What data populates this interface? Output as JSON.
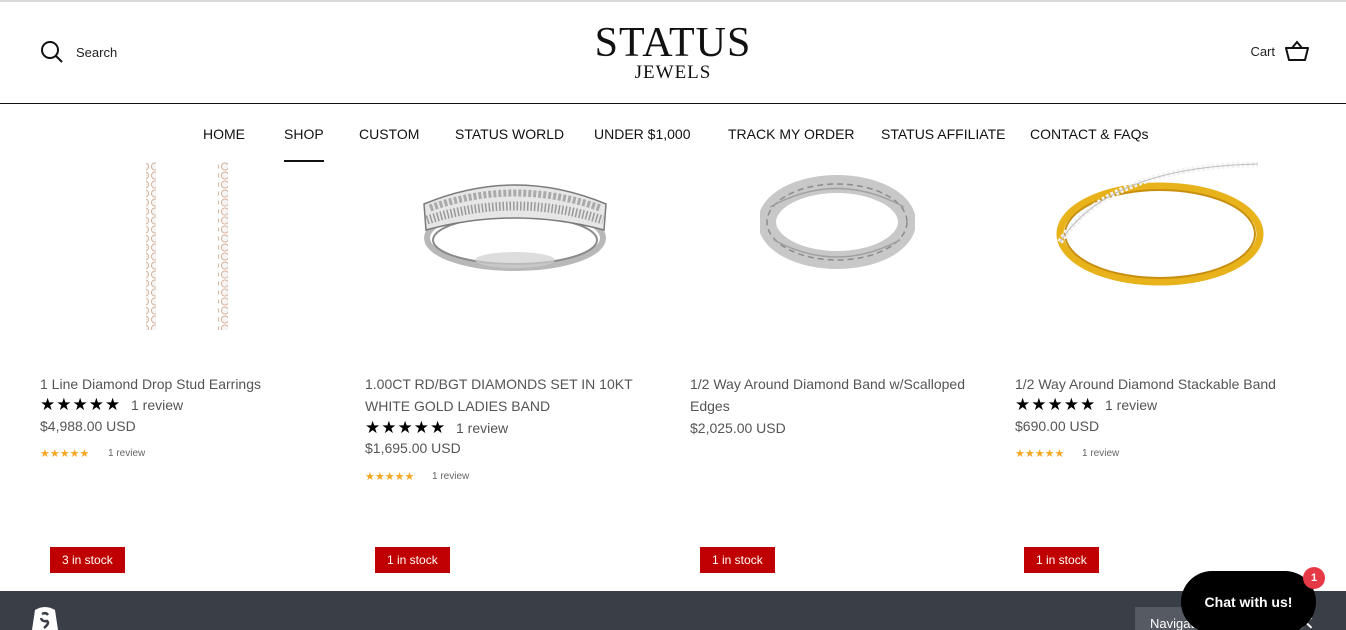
{
  "header": {
    "search_label": "Search",
    "logo_line1": "STATUS",
    "logo_line2": "JEWELS",
    "cart_label": "Cart"
  },
  "nav": {
    "items": [
      {
        "label": "HOME"
      },
      {
        "label": "SHOP",
        "active": true
      },
      {
        "label": "CUSTOM"
      },
      {
        "label": "STATUS WORLD"
      },
      {
        "label": "UNDER $1,000"
      },
      {
        "label": "TRACK MY ORDER"
      },
      {
        "label": "STATUS AFFILIATE"
      },
      {
        "label": "CONTACT & FAQs"
      }
    ]
  },
  "products": [
    {
      "title": "1 Line Diamond Drop Stud Earrings",
      "stars": "★★★★★",
      "review_text": "1 review",
      "price": "$4,988.00 USD",
      "stars_small": "★★★★★",
      "review_small": "1 review",
      "stock": "3 in stock"
    },
    {
      "title": "1.00CT RD/BGT DIAMONDS SET IN 10KT WHITE GOLD LADIES BAND",
      "stars": "★★★★★",
      "review_text": "1 review",
      "price": "$1,695.00 USD",
      "stars_small": "★★★★★",
      "review_small": "1 review",
      "stock": "1 in stock"
    },
    {
      "title": "1/2 Way Around Diamond Band w/Scalloped Edges",
      "price": "$2,025.00 USD",
      "stock": "1 in stock"
    },
    {
      "title": "1/2 Way Around Diamond Stackable Band",
      "stars": "★★★★★",
      "review_text": "1 review",
      "price": "$690.00 USD",
      "stars_small": "★★★★★",
      "review_small": "1 review",
      "stock": "1 in stock"
    }
  ],
  "footer": {
    "navigate_label": "Navigate",
    "close_symbol": "✕"
  },
  "chat": {
    "label": "Chat with us!",
    "badge_count": "1"
  },
  "colors": {
    "stock_badge": "#c00000",
    "star_small": "#f5a623",
    "footer_bar": "#3a3f47",
    "chat_badge": "#e63946"
  }
}
